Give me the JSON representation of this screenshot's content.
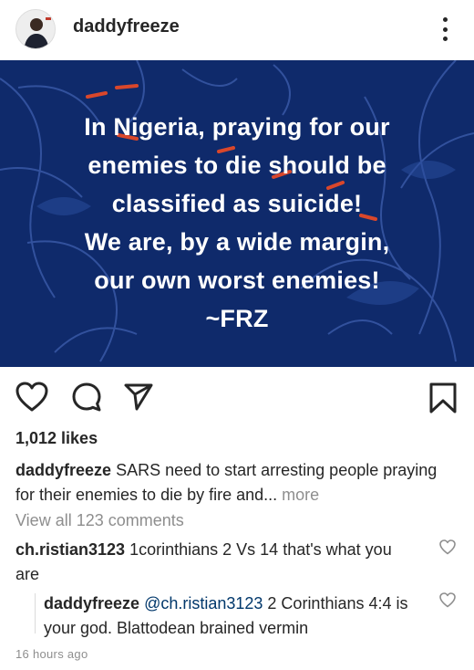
{
  "post": {
    "username": "daddyfreeze",
    "image_text": [
      "In Nigeria, praying for our",
      "enemies to die should be",
      "classified as suicide!",
      "We are, by a wide margin,",
      "our own worst enemies!",
      "~FRZ"
    ],
    "likes": "1,012 likes",
    "caption_user": "daddyfreeze",
    "caption_text": "SARS need to start arresting people praying for their enemies to die by fire and...",
    "caption_more": "more",
    "view_all_comments": "View all 123 comments",
    "timestamp": "16 hours ago"
  },
  "comments": [
    {
      "user": "ch.ristian3123",
      "text": "1corinthians 2 Vs 14 that's what you are"
    },
    {
      "user": "daddyfreeze",
      "mention": "@ch.ristian3123",
      "text": "2 Corinthians 4:4  is your god. Blattodean brained vermin"
    }
  ],
  "icons": {
    "more": "more-options-icon",
    "like": "heart-icon",
    "comment": "comment-icon",
    "share": "share-icon",
    "save": "bookmark-icon"
  },
  "colors": {
    "image_background": "#0f2a6b",
    "text": "#262626",
    "muted": "#8e8e8e",
    "mention": "#00376b"
  }
}
